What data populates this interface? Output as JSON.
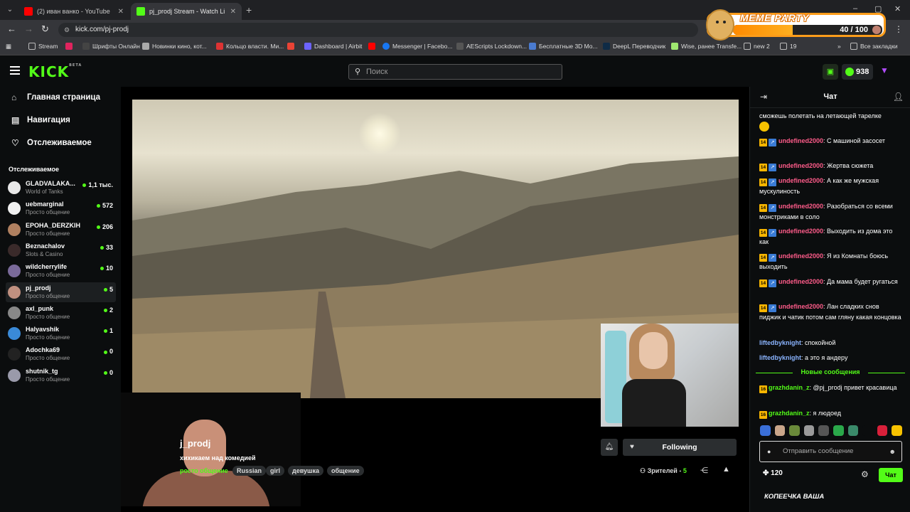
{
  "browser": {
    "tabs": [
      {
        "title": "(2) иван ванко - YouTube",
        "color": "#ff0000"
      },
      {
        "title": "pj_prodj Stream - Watch Li",
        "color": "#53fc18"
      }
    ],
    "url": "kick.com/pj-prodj",
    "bookmarks": [
      {
        "label": "Stream",
        "color": "#888"
      },
      {
        "label": "",
        "color": "#e0245e"
      },
      {
        "label": "Шрифты Онлайн",
        "color": "#555"
      },
      {
        "label": "Новинки кино, кот...",
        "color": "#aaa"
      },
      {
        "label": "Кольцо власти. Ми...",
        "color": "#d33"
      },
      {
        "label": "",
        "color": "#ea4335"
      },
      {
        "label": "Dashboard | Airbit",
        "color": "#6c63ff"
      },
      {
        "label": "",
        "color": "#ff0000"
      },
      {
        "label": "Messenger | Facebo...",
        "color": "#1877f2"
      },
      {
        "label": "AEScripts Lockdown...",
        "color": "#555"
      },
      {
        "label": "Бесплатные 3D Mo...",
        "color": "#4a7bd0"
      },
      {
        "label": "DeepL Переводчик",
        "color": "#0f2b46"
      },
      {
        "label": "Wise, ранее Transfe...",
        "color": "#9fe870"
      },
      {
        "label": "new 2",
        "color": "#888"
      },
      {
        "label": "19",
        "color": "#888"
      },
      {
        "label": "Все закладки",
        "color": "#888"
      }
    ]
  },
  "overlay": {
    "title": "MEME PARTY",
    "counter": "40 / 100",
    "progress": 0.4
  },
  "nav": {
    "logo": "KICK",
    "logo_badge": "BETA",
    "search_placeholder": "Поиск",
    "coins": "938"
  },
  "sidebar": {
    "menu": [
      "Главная страница",
      "Навигация",
      "Отслеживаемое"
    ],
    "following_header": "Отслеживаемое",
    "channels": [
      {
        "name": "GLADVALAKA...",
        "category": "World of Tanks",
        "viewers": "1,1 тыс.",
        "color": "#e8e8e8"
      },
      {
        "name": "uebmarginal",
        "category": "Просто общение",
        "viewers": "572",
        "color": "#f0f0f0"
      },
      {
        "name": "EPOHA_DERZKIH",
        "category": "Просто общение",
        "viewers": "206",
        "color": "#b08060"
      },
      {
        "name": "Beznachalov",
        "category": "Slots & Casino",
        "viewers": "33",
        "color": "#3a2a2a"
      },
      {
        "name": "wildcherrylife",
        "category": "Просто общение",
        "viewers": "10",
        "color": "#7a6a9a"
      },
      {
        "name": "pj_prodj",
        "category": "Просто общение",
        "viewers": "5",
        "color": "#c09080",
        "active": true
      },
      {
        "name": "axl_punk",
        "category": "Просто общение",
        "viewers": "2",
        "color": "#888"
      },
      {
        "name": "Halyavshik",
        "category": "Просто общение",
        "viewers": "1",
        "color": "#3a8ad8"
      },
      {
        "name": "Adochka69",
        "category": "Просто общение",
        "viewers": "0",
        "color": "#222"
      },
      {
        "name": "shutnik_tg",
        "category": "Просто общение",
        "viewers": "0",
        "color": "#9a9aaa"
      }
    ]
  },
  "stream": {
    "title": "j_prodj",
    "subtitle": "хихикаем над комедией",
    "category": "росто общение",
    "tags": [
      "Russian",
      "girl",
      "девушка",
      "общение"
    ],
    "follow_label": "Following",
    "viewers_label": "Зрителей -",
    "viewers_count": "5"
  },
  "chat": {
    "title": "Чат",
    "messages": [
      {
        "user": "",
        "text": "сможешь полетать на летающей тарелке",
        "color": "#fff",
        "badges": false,
        "emoji": true
      },
      {
        "user": "undefined2000",
        "text": ": С машиной засосет",
        "color": "#ff5c8a",
        "badges": true
      },
      {
        "user": "undefined2000",
        "text": ": Жертва сюжета",
        "color": "#ff5c8a",
        "badges": true
      },
      {
        "user": "undefined2000",
        "text": ": А как же мужская мускулиность",
        "color": "#ff5c8a",
        "badges": true
      },
      {
        "user": "undefined2000",
        "text": ": Разобраться со всеми монстриками в соло",
        "color": "#ff5c8a",
        "badges": true
      },
      {
        "user": "undefined2000",
        "text": ": Выходить из дома это как",
        "color": "#ff5c8a",
        "badges": true
      },
      {
        "user": "undefined2000",
        "text": ": Я из Комнаты боюсь выходить",
        "color": "#ff5c8a",
        "badges": true
      },
      {
        "user": "undefined2000",
        "text": ": Да мама будет ругаться",
        "color": "#ff5c8a",
        "badges": true
      },
      {
        "user": "undefined2000",
        "text": ": Лан сладких снов пиджик и чатик потом сам гляну какая концовка",
        "color": "#ff5c8a",
        "badges": true
      },
      {
        "user": "liftedbyknight",
        "text": ": спокойной",
        "color": "#8ab4ff",
        "badges": false
      },
      {
        "user": "liftedbyknight",
        "text": ": а это я андеру",
        "color": "#8ab4ff",
        "badges": false
      }
    ],
    "new_messages_label": "Новые сообщения",
    "new_messages": [
      {
        "user": "grazhdanin_z",
        "text": ": @pj_prodj привет красавица",
        "color": "#53fc18"
      },
      {
        "user": "grazhdanin_z",
        "text": ": я людоед",
        "color": "#53fc18"
      }
    ],
    "input_placeholder": "Отправить сообщение",
    "points": "120",
    "send_label": "Чат",
    "footer_text": "КОПЕЕЧКА ВАША"
  }
}
